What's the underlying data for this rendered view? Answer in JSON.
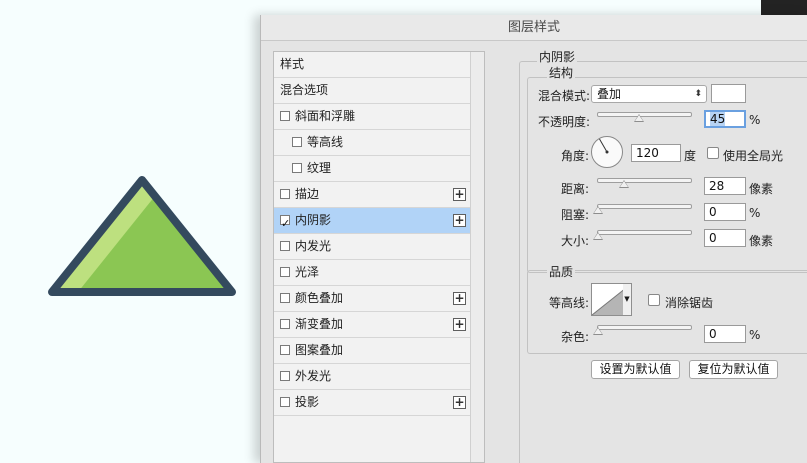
{
  "dialog": {
    "title": "图层样式"
  },
  "style_list": [
    {
      "label": "样式",
      "checkbox": false,
      "checked": false,
      "plus": false,
      "indent": false,
      "selected": false
    },
    {
      "label": "混合选项",
      "checkbox": false,
      "checked": false,
      "plus": false,
      "indent": false,
      "selected": false
    },
    {
      "label": "斜面和浮雕",
      "checkbox": true,
      "checked": false,
      "plus": false,
      "indent": false,
      "selected": false
    },
    {
      "label": "等高线",
      "checkbox": true,
      "checked": false,
      "plus": false,
      "indent": true,
      "selected": false
    },
    {
      "label": "纹理",
      "checkbox": true,
      "checked": false,
      "plus": false,
      "indent": true,
      "selected": false
    },
    {
      "label": "描边",
      "checkbox": true,
      "checked": false,
      "plus": true,
      "indent": false,
      "selected": false
    },
    {
      "label": "内阴影",
      "checkbox": true,
      "checked": true,
      "plus": true,
      "indent": false,
      "selected": true
    },
    {
      "label": "内发光",
      "checkbox": true,
      "checked": false,
      "plus": false,
      "indent": false,
      "selected": false
    },
    {
      "label": "光泽",
      "checkbox": true,
      "checked": false,
      "plus": false,
      "indent": false,
      "selected": false
    },
    {
      "label": "颜色叠加",
      "checkbox": true,
      "checked": false,
      "plus": true,
      "indent": false,
      "selected": false
    },
    {
      "label": "渐变叠加",
      "checkbox": true,
      "checked": false,
      "plus": true,
      "indent": false,
      "selected": false
    },
    {
      "label": "图案叠加",
      "checkbox": true,
      "checked": false,
      "plus": false,
      "indent": false,
      "selected": false
    },
    {
      "label": "外发光",
      "checkbox": true,
      "checked": false,
      "plus": false,
      "indent": false,
      "selected": false
    },
    {
      "label": "投影",
      "checkbox": true,
      "checked": false,
      "plus": true,
      "indent": false,
      "selected": false
    }
  ],
  "inner_shadow": {
    "section_title": "内阴影",
    "structure": {
      "title": "结构",
      "blend_mode_label": "混合模式:",
      "blend_mode_value": "叠加",
      "blend_color": "#ffffff",
      "opacity_label": "不透明度:",
      "opacity_value": "45",
      "opacity_unit": "%",
      "opacity_slider": 0.45,
      "angle_label": "角度:",
      "angle_value": "120",
      "angle_unit": "度",
      "global_light_label": "使用全局光",
      "global_light_checked": false,
      "distance_label": "距离:",
      "distance_value": "28",
      "distance_unit": "像素",
      "distance_slider": 0.28,
      "choke_label": "阻塞:",
      "choke_value": "0",
      "choke_unit": "%",
      "choke_slider": 0,
      "size_label": "大小:",
      "size_value": "0",
      "size_unit": "像素",
      "size_slider": 0
    },
    "quality": {
      "title": "品质",
      "contour_label": "等高线:",
      "anti_alias_label": "消除锯齿",
      "anti_alias_checked": false,
      "noise_label": "杂色:",
      "noise_value": "0",
      "noise_unit": "%",
      "noise_slider": 0
    },
    "buttons": {
      "make_default": "设置为默认值",
      "reset_default": "复位为默认值"
    }
  },
  "colors": {
    "triangle_fill": "#8bc653",
    "triangle_highlight": "#bde07f",
    "triangle_stroke": "#344a5e",
    "selection": "#b1d3f7"
  }
}
